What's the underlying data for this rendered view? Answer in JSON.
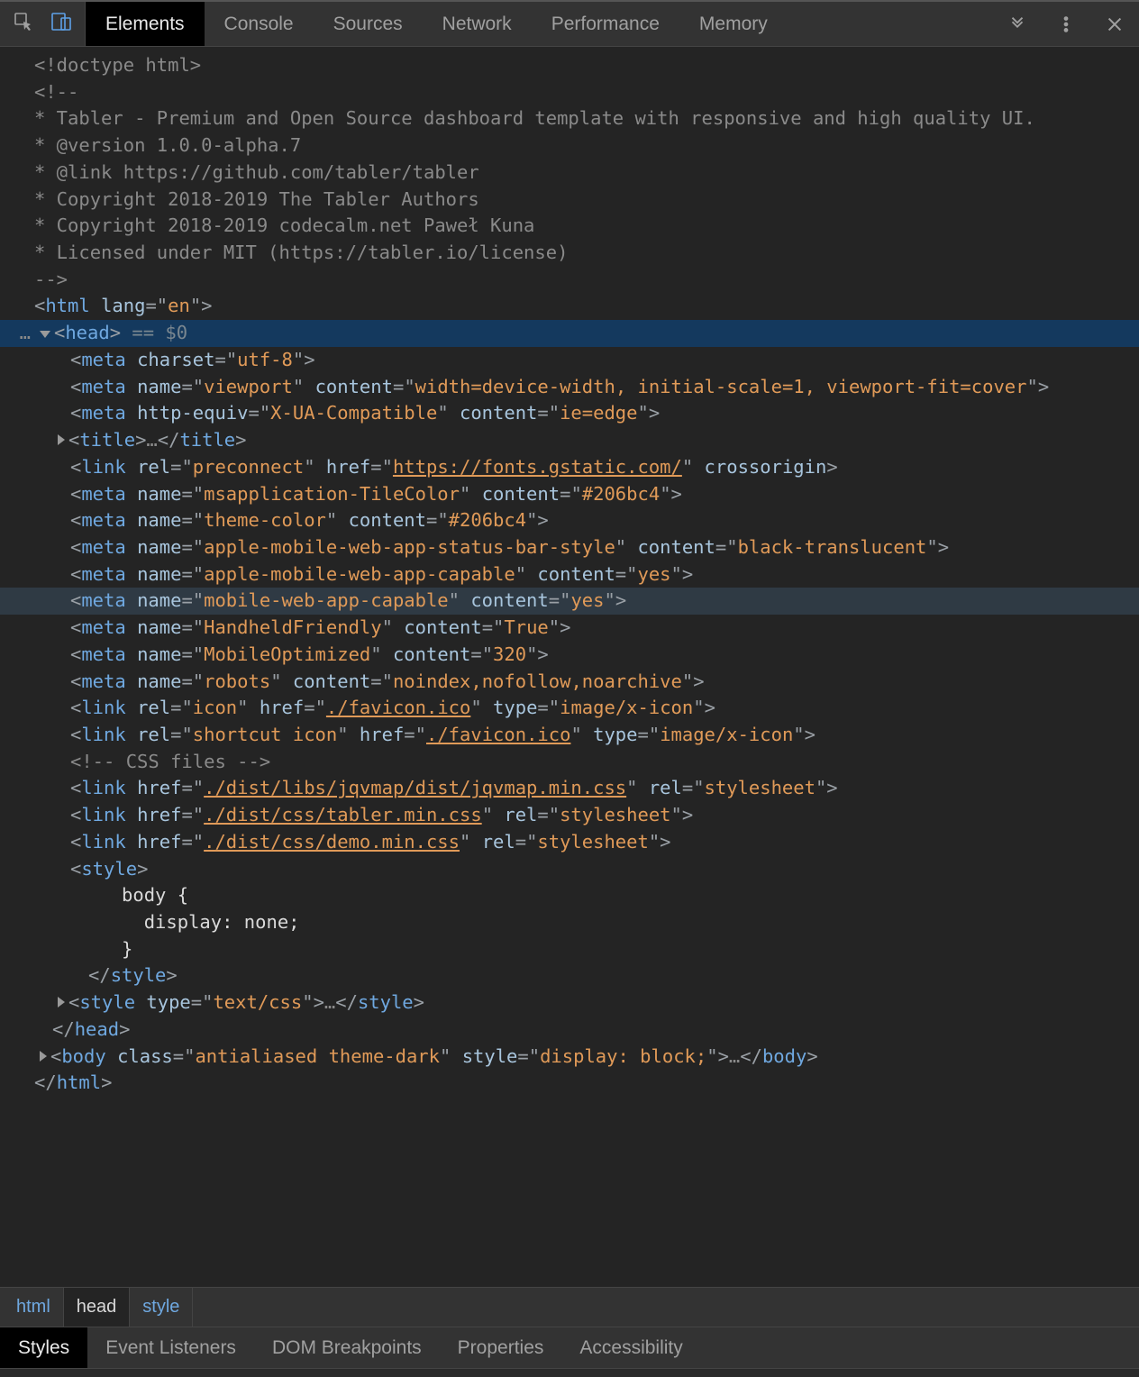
{
  "toolbar": {
    "tabs": [
      "Elements",
      "Console",
      "Sources",
      "Network",
      "Performance",
      "Memory"
    ],
    "active_tab_index": 0
  },
  "dom": {
    "lines": [
      {
        "indent": 0,
        "kind": "doctype",
        "raw": "<!doctype html>"
      },
      {
        "indent": 0,
        "kind": "cmt",
        "raw": "<!--"
      },
      {
        "indent": 0,
        "kind": "cmt",
        "raw": "* Tabler - Premium and Open Source dashboard template with responsive and high quality UI."
      },
      {
        "indent": 0,
        "kind": "cmt",
        "raw": "* @version 1.0.0-alpha.7"
      },
      {
        "indent": 0,
        "kind": "cmt",
        "raw": "* @link https://github.com/tabler/tabler"
      },
      {
        "indent": 0,
        "kind": "cmt",
        "raw": "* Copyright 2018-2019 The Tabler Authors"
      },
      {
        "indent": 0,
        "kind": "cmt",
        "raw": "* Copyright 2018-2019 codecalm.net Paweł Kuna"
      },
      {
        "indent": 0,
        "kind": "cmt",
        "raw": "* Licensed under MIT (https://tabler.io/license)"
      },
      {
        "indent": 0,
        "kind": "cmt",
        "raw": "-->"
      },
      {
        "indent": 0,
        "kind": "open",
        "tag": "html",
        "attrs": [
          [
            "lang",
            "en"
          ]
        ],
        "close": ">"
      },
      {
        "indent": 1,
        "selected": true,
        "marker": "down",
        "gutter": "…",
        "kind": "open",
        "tag": "head",
        "attrs": [],
        "close": ">",
        "suffix_ghost": " == $0"
      },
      {
        "indent": 2,
        "kind": "void",
        "tag": "meta",
        "attrs": [
          [
            "charset",
            "utf-8"
          ]
        ]
      },
      {
        "indent": 2,
        "kind": "void",
        "tag": "meta",
        "attrs": [
          [
            "name",
            "viewport"
          ],
          [
            "content",
            "width=device-width, initial-scale=1, viewport-fit=cover"
          ]
        ]
      },
      {
        "indent": 2,
        "kind": "void",
        "tag": "meta",
        "attrs": [
          [
            "http-equiv",
            "X-UA-Compatible"
          ],
          [
            "content",
            "ie=edge"
          ]
        ]
      },
      {
        "indent": 2,
        "marker": "right",
        "kind": "collapsed",
        "tag": "title",
        "mid": "…"
      },
      {
        "indent": 2,
        "kind": "void",
        "tag": "link",
        "attrs": [
          [
            "rel",
            "preconnect"
          ],
          [
            "href",
            "https://fonts.gstatic.com/",
            true
          ],
          [
            "~",
            "crossorigin"
          ]
        ]
      },
      {
        "indent": 2,
        "kind": "void",
        "tag": "meta",
        "attrs": [
          [
            "name",
            "msapplication-TileColor"
          ],
          [
            "content",
            "#206bc4"
          ]
        ]
      },
      {
        "indent": 2,
        "kind": "void",
        "tag": "meta",
        "attrs": [
          [
            "name",
            "theme-color"
          ],
          [
            "content",
            "#206bc4"
          ]
        ]
      },
      {
        "indent": 2,
        "kind": "void",
        "tag": "meta",
        "attrs": [
          [
            "name",
            "apple-mobile-web-app-status-bar-style"
          ],
          [
            "content",
            "black-translucent"
          ]
        ]
      },
      {
        "indent": 2,
        "kind": "void",
        "tag": "meta",
        "attrs": [
          [
            "name",
            "apple-mobile-web-app-capable"
          ],
          [
            "content",
            "yes"
          ]
        ]
      },
      {
        "indent": 2,
        "hover": true,
        "kind": "void",
        "tag": "meta",
        "attrs": [
          [
            "name",
            "mobile-web-app-capable"
          ],
          [
            "content",
            "yes"
          ]
        ]
      },
      {
        "indent": 2,
        "kind": "void",
        "tag": "meta",
        "attrs": [
          [
            "name",
            "HandheldFriendly"
          ],
          [
            "content",
            "True"
          ]
        ]
      },
      {
        "indent": 2,
        "kind": "void",
        "tag": "meta",
        "attrs": [
          [
            "name",
            "MobileOptimized"
          ],
          [
            "content",
            "320"
          ]
        ]
      },
      {
        "indent": 2,
        "kind": "void",
        "tag": "meta",
        "attrs": [
          [
            "name",
            "robots"
          ],
          [
            "content",
            "noindex,nofollow,noarchive"
          ]
        ]
      },
      {
        "indent": 2,
        "kind": "void",
        "tag": "link",
        "attrs": [
          [
            "rel",
            "icon"
          ],
          [
            "href",
            "./favicon.ico",
            true
          ],
          [
            "type",
            "image/x-icon"
          ]
        ]
      },
      {
        "indent": 2,
        "kind": "void",
        "tag": "link",
        "attrs": [
          [
            "rel",
            "shortcut icon"
          ],
          [
            "href",
            "./favicon.ico",
            true
          ],
          [
            "type",
            "image/x-icon"
          ]
        ]
      },
      {
        "indent": 2,
        "kind": "cmt",
        "raw": "<!-- CSS files -->"
      },
      {
        "indent": 2,
        "kind": "void",
        "tag": "link",
        "attrs": [
          [
            "href",
            "./dist/libs/jqvmap/dist/jqvmap.min.css",
            true
          ],
          [
            "rel",
            "stylesheet"
          ]
        ]
      },
      {
        "indent": 2,
        "kind": "void",
        "tag": "link",
        "attrs": [
          [
            "href",
            "./dist/css/tabler.min.css",
            true
          ],
          [
            "rel",
            "stylesheet"
          ]
        ]
      },
      {
        "indent": 2,
        "kind": "void",
        "tag": "link",
        "attrs": [
          [
            "href",
            "./dist/css/demo.min.css",
            true
          ],
          [
            "rel",
            "stylesheet"
          ]
        ]
      },
      {
        "indent": 2,
        "kind": "open",
        "tag": "style",
        "attrs": [],
        "close": ">"
      },
      {
        "indent": 3,
        "kind": "body",
        "raw": "   body {"
      },
      {
        "indent": 3,
        "kind": "body",
        "raw": "     display: none;"
      },
      {
        "indent": 3,
        "kind": "body",
        "raw": "   }"
      },
      {
        "indent": 3,
        "kind": "closeTag",
        "tag": "style"
      },
      {
        "indent": 2,
        "marker": "right",
        "kind": "collapsed",
        "tag": "style",
        "attrs": [
          [
            "type",
            "text/css"
          ]
        ],
        "mid": "…"
      },
      {
        "indent": 1,
        "kind": "closeTag",
        "tag": "head"
      },
      {
        "indent": 1,
        "marker": "right",
        "kind": "collapsed",
        "tag": "body",
        "attrs": [
          [
            "class",
            "antialiased theme-dark"
          ],
          [
            "style",
            "display: block;"
          ]
        ],
        "mid": "…"
      },
      {
        "indent": 0,
        "kind": "closeTag",
        "tag": "html"
      }
    ]
  },
  "crumbs": [
    "html",
    "head",
    "style"
  ],
  "crumbs_active_index": 1,
  "subtabs": [
    "Styles",
    "Event Listeners",
    "DOM Breakpoints",
    "Properties",
    "Accessibility"
  ],
  "subtabs_active_index": 0
}
